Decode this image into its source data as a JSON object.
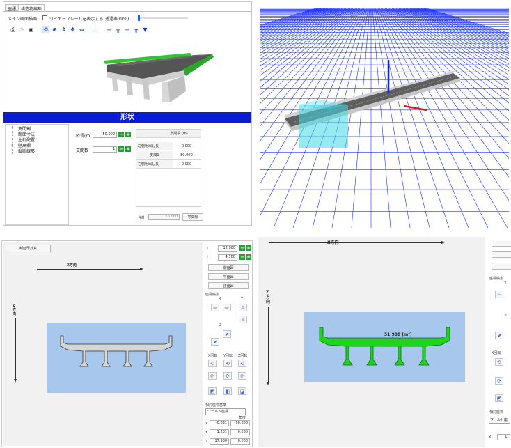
{
  "top_left": {
    "tabs": [
      "座標",
      "構造物編集"
    ],
    "toolbar": {
      "main_redraw": "メイン画面描画",
      "wireframe_label": "ワイヤーフレームを表示する",
      "transparency_label": "透過率:0(%)",
      "transparency_value": 0
    },
    "shape_header": "形状",
    "tree": [
      "支間割",
      "断面寸法",
      "主桁配置",
      "壁高欄",
      "縦断線形"
    ],
    "form": {
      "girder_length_label": "桁長(m)",
      "girder_length_value": "50.000",
      "span_count_label": "支間数",
      "span_count_value": "1"
    },
    "span_table": {
      "header": "支間長 (m)",
      "rows": [
        {
          "label": "左側桁出し長",
          "value": "0.000"
        },
        {
          "label": "支間1",
          "value": "50.000"
        },
        {
          "label": "右側桁出し長",
          "value": "0.000"
        }
      ],
      "total_label": "合計",
      "total_value": "50.000",
      "equal_button": "等間隔"
    }
  },
  "bottom_left": {
    "redisplay_button": "断面再計算",
    "x_axis_label": "X方向",
    "z_axis_label": "Z\n方\n向",
    "side": {
      "x_label": "X",
      "x_value": "12.000",
      "z_label": "Z",
      "z_value": "4.700",
      "view_buttons": [
        "側面図",
        "平面図",
        "正面図"
      ],
      "coord_edit_label": "座標編集",
      "coord_x": "X",
      "coord_y": "Y",
      "coord_z": "Z",
      "rot_labels": [
        "X回転",
        "Y回転",
        "Z回転"
      ],
      "relative_label": "相対座標基準",
      "relative_select": "ワールド座標",
      "angle_label": "角度",
      "rows": [
        {
          "axis": "X",
          "value": "-0.031",
          "angle": "90.000"
        },
        {
          "axis": "Y",
          "value": "1.281",
          "angle": "0.000"
        },
        {
          "axis": "Z",
          "value": "17.960",
          "angle": "0.000"
        }
      ]
    }
  },
  "bottom_right": {
    "x_axis_label": "X方向",
    "z_axis_label": "Z\n方\n向",
    "area_label": "51.988 (m²)",
    "side": {
      "coord_edit_label": "座標編集",
      "coord_x": "X",
      "coord_z": "Z",
      "rot_label": "X回転",
      "relative_label": "相対座標",
      "relative_select": "ワールド座",
      "x_label": "X",
      "x_value": "1."
    }
  },
  "colors": {
    "shape_header_bg": "#0b1cd6",
    "section_fill_gray": "#d6d6d6",
    "section_fill_green": "#1fd41f",
    "viewport_bg": "#a7c8ec",
    "grid_blue": "#1830ff",
    "accent_green": "#25a035"
  }
}
